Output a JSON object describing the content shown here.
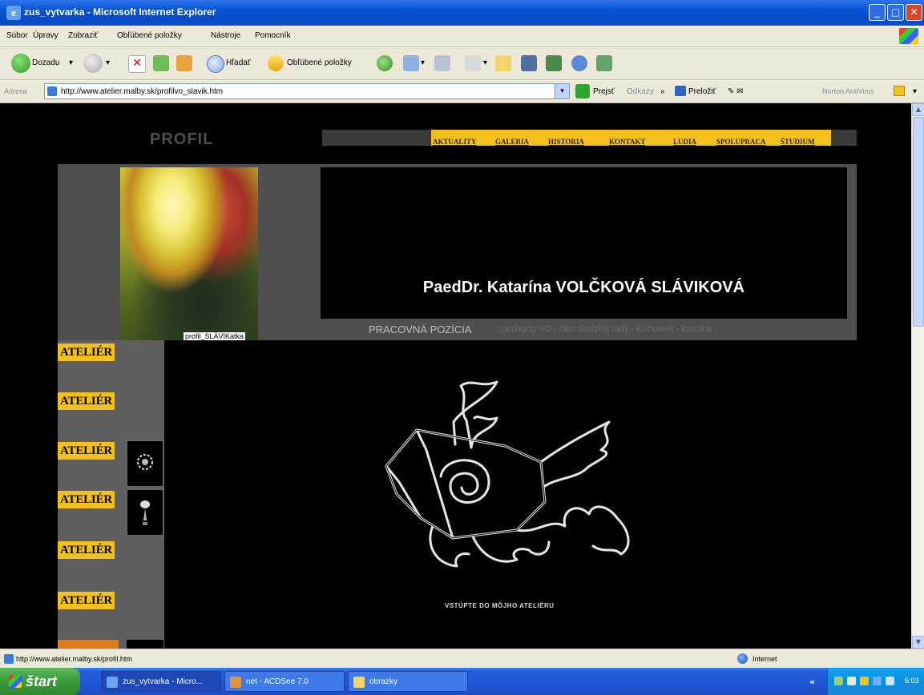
{
  "window": {
    "title": "zus_vytvarka - Microsoft Internet Explorer"
  },
  "menu": [
    "Súbor",
    "Úpravy",
    "Zobraziť",
    "Obľúbené položky",
    "Nástroje",
    "Pomocník"
  ],
  "toolbar": {
    "back": "Dozadu",
    "search": "Hľadať",
    "favorites": "Obľúbené položky"
  },
  "address": {
    "label": "Adresa",
    "url": "http://www.atelier.malby.sk/profilvo_slavik.htm",
    "go": "Prejsť",
    "links": "Odkazy",
    "translate": "Preložiť",
    "norton": "Norton AntiVirus"
  },
  "page": {
    "profil_title": "PROFIL",
    "nav": [
      "AKTUALITY",
      "GALERIA",
      "HISTORIA",
      "KONTAKT",
      "LUDIA",
      "SPOLUPRACA",
      "ŠTUDIUM"
    ],
    "photo_caption": "profil_SLÁVIKatka",
    "name": "PaedDr. Katarína VOLČKOVÁ SLÁVIKOVÁ",
    "position_label": "PRACOVNÁ POZÍCIA",
    "position_value": ": pedagóg VO - člen školskej rady - knihovník - kronikár",
    "atelier_items": [
      "ATELIÉR",
      "ATELIÉR",
      "ATELIÉR",
      "ATELIÉR",
      "ATELIÉR",
      "ATELIÉR"
    ],
    "enter_text": "VSTÚPTE DO MÔJHO ATELIÉRU"
  },
  "status": {
    "url": "http://www.atelier.malby.sk/profil.htm",
    "zone": "Internet"
  },
  "taskbar": {
    "start": "štart",
    "tasks": [
      "zus_vytvarka - Micro...",
      "net - ACDSee 7.0",
      "obrazky"
    ]
  }
}
